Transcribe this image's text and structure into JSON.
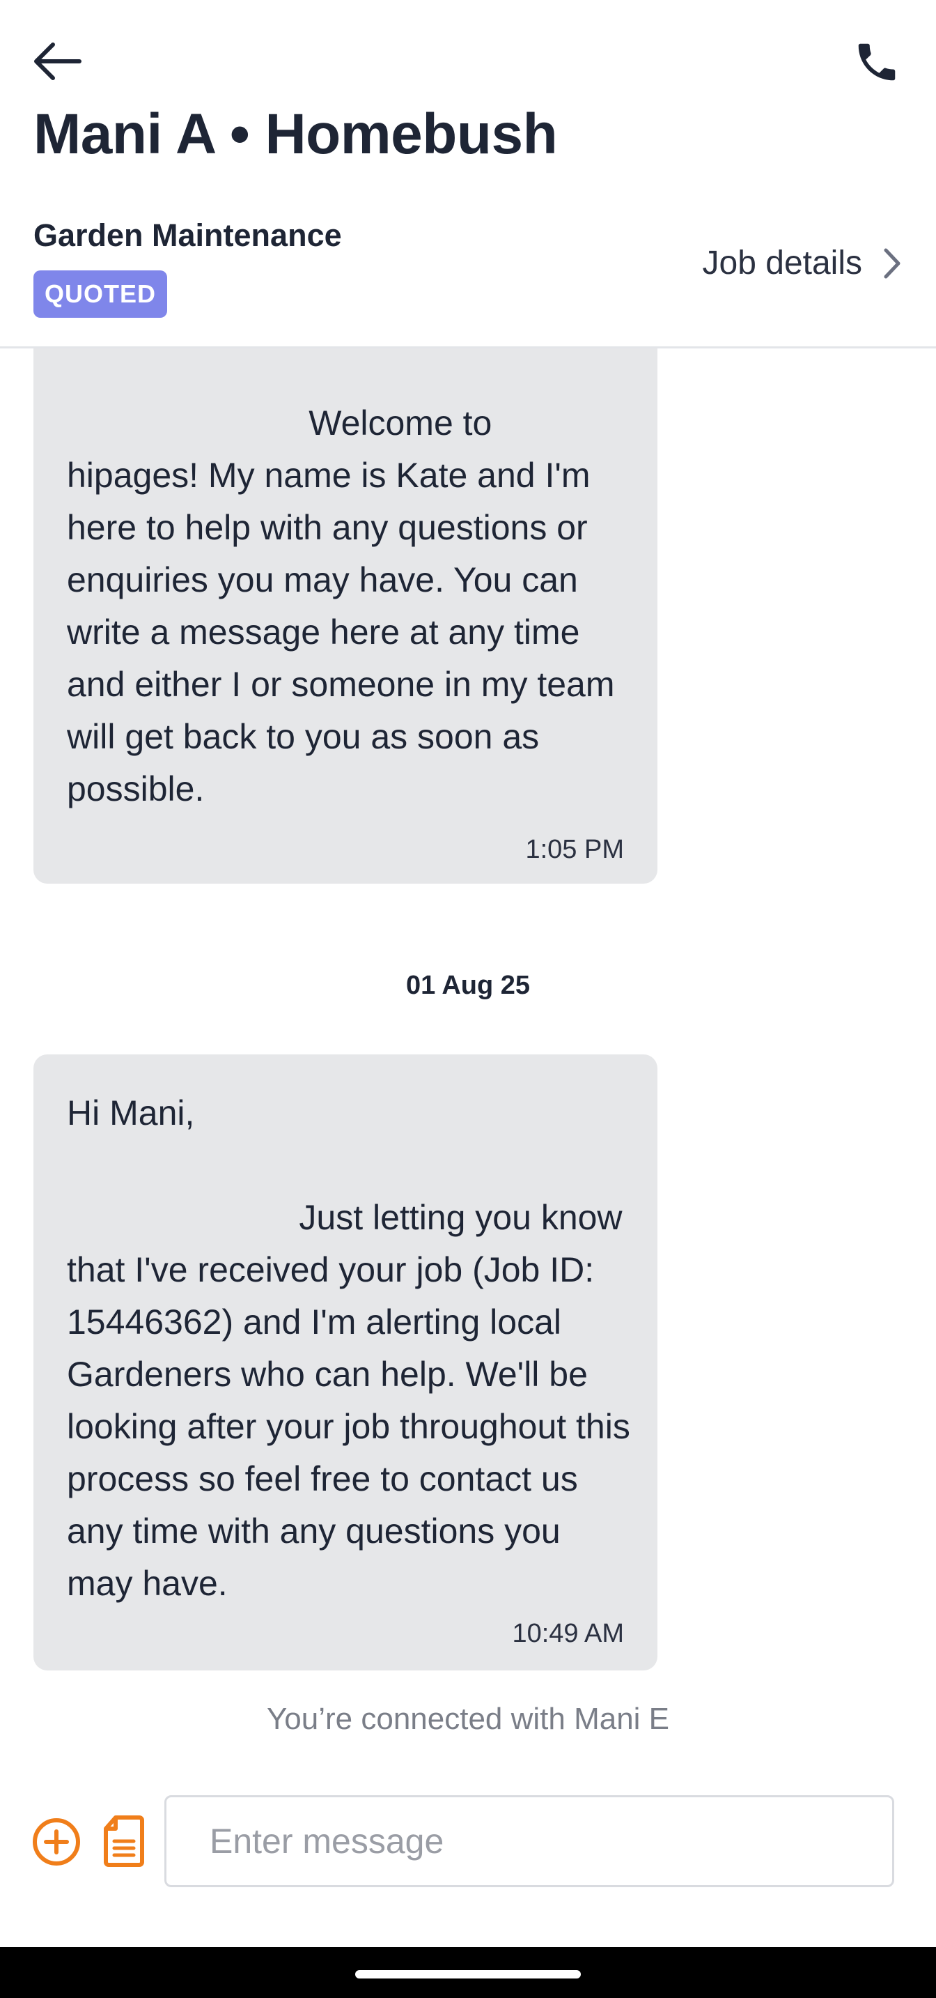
{
  "header": {
    "title": "Mani A • Homebush",
    "category": "Garden Maintenance",
    "status_badge": "QUOTED",
    "job_details_label": "Job details",
    "back_icon": "arrow-left-icon",
    "call_icon": "phone-icon"
  },
  "messages": [
    {
      "text": "                         Welcome to hipages! My name is Kate and I'm here to help with any questions or enquiries you may have. You can write a message here at any time and either I or someone in my team will get back to you as soon as possible.",
      "time": "1:05 PM"
    },
    {
      "text": "Hi Mani,\n\n                        Just letting you know that I've received your job (Job ID: 15446362) and I'm alerting local Gardeners who can help. We'll be looking after your job throughout this process so feel free to contact us any time with any questions you may have.",
      "time": "10:49 AM"
    }
  ],
  "date_separator": "01 Aug 25",
  "connected_text": "You’re connected with Mani E",
  "composer": {
    "placeholder": "Enter message",
    "add_icon": "plus-circle-icon",
    "doc_icon": "document-icon"
  },
  "colors": {
    "accent": "#f07e1a",
    "badge": "#7f86ea",
    "bubble": "#e6e7e9",
    "text": "#1e2535"
  }
}
